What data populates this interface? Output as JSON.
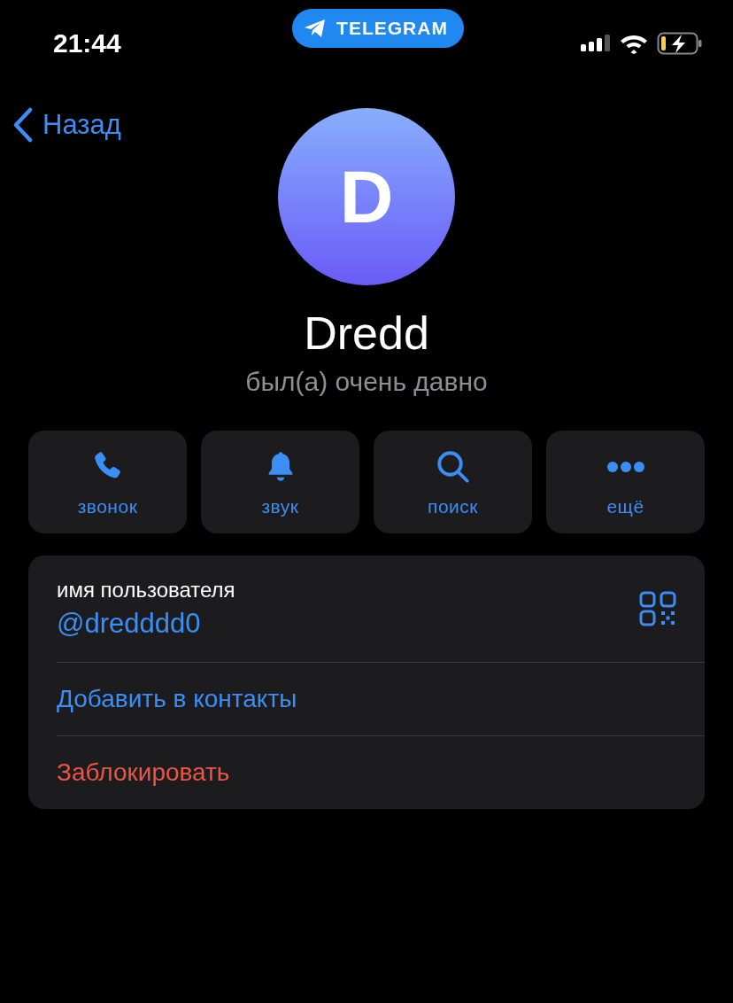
{
  "status_bar": {
    "time": "21:44",
    "app_badge": "TELEGRAM"
  },
  "nav": {
    "back": "Назад"
  },
  "profile": {
    "initial": "D",
    "name": "Dredd",
    "status": "был(а) очень давно"
  },
  "actions": [
    {
      "kind": "call",
      "label": "звонок"
    },
    {
      "kind": "sound",
      "label": "звук"
    },
    {
      "kind": "search",
      "label": "поиск"
    },
    {
      "kind": "more",
      "label": "ещё"
    }
  ],
  "info": [
    {
      "kind": "username",
      "caption": "имя пользователя",
      "value": "@dredddd0"
    },
    {
      "kind": "action",
      "label": "Добавить в контакты"
    },
    {
      "kind": "destructive",
      "label": "Заблокировать"
    }
  ]
}
